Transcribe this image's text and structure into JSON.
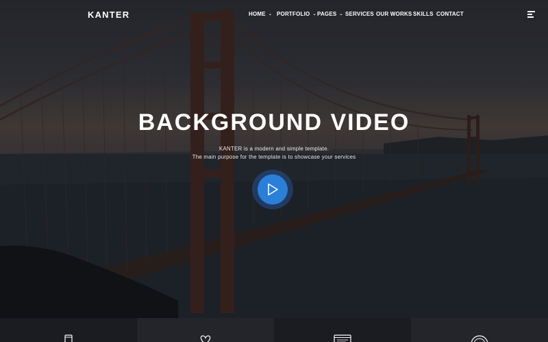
{
  "brand": {
    "logo": "KANTER"
  },
  "nav": {
    "items": [
      {
        "label": "HOME",
        "caret": "⌄"
      },
      {
        "label": "PORTFOLIO",
        "caret": "⌄"
      },
      {
        "label": "PAGES",
        "caret": "⌄"
      },
      {
        "label": "SERVICES",
        "caret": ""
      },
      {
        "label": "OUR WORKS",
        "caret": ""
      },
      {
        "label": "SKILLS",
        "caret": ""
      },
      {
        "label": "CONTACT",
        "caret": ""
      }
    ],
    "menu_icon": "hamburger-icon"
  },
  "hero": {
    "title": "BACKGROUND VIDEO",
    "subtitle_line1": "KANTER is a modern and simple template.",
    "subtitle_line2": "The main purpose for the template is to showcase your services",
    "play_icon": "play-icon",
    "accent_color": "#2b7fd9"
  },
  "features": [
    {
      "icon": "mobile-icon"
    },
    {
      "icon": "heart-icon"
    },
    {
      "icon": "browser-window-icon"
    },
    {
      "icon": "globe-icon"
    }
  ]
}
